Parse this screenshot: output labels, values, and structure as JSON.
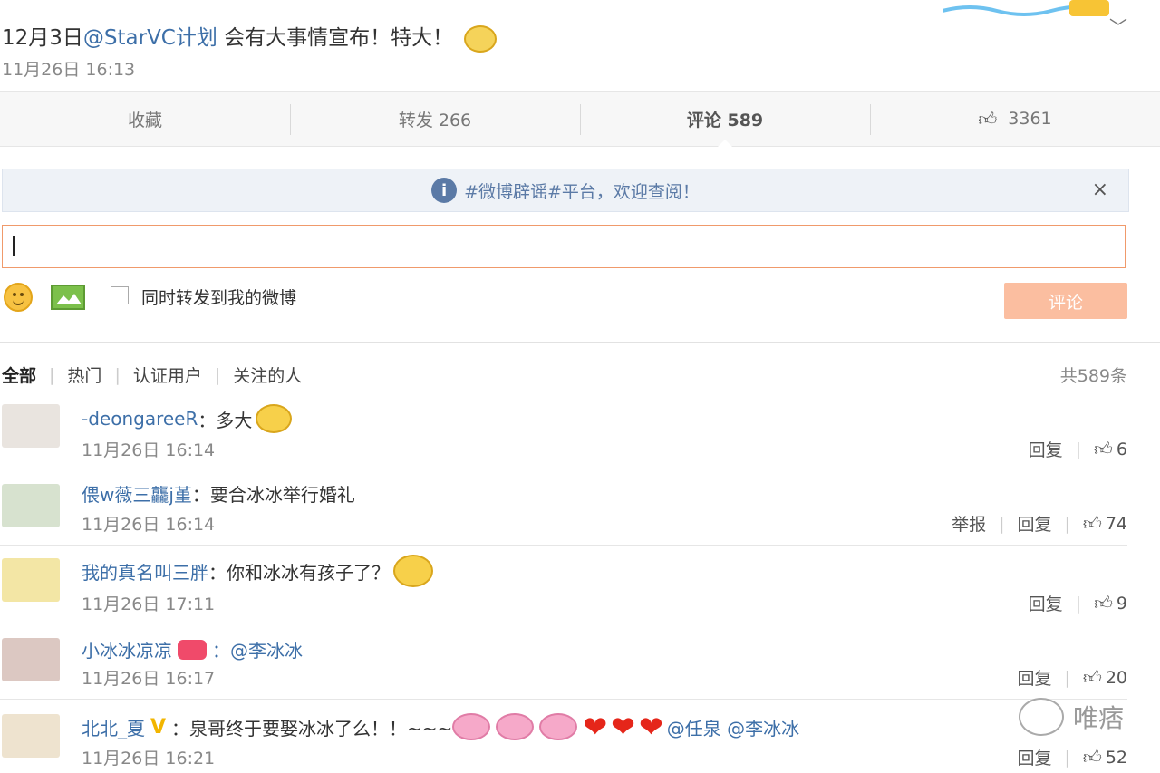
{
  "post": {
    "text_prefix": "12月3日",
    "mention": "@StarVC计划",
    "text_suffix": " 会有大事情宣布！特大！",
    "time": "11月26日 16:13"
  },
  "actions": {
    "favorite": "收藏",
    "repost": "转发 266",
    "comment": "评论 589",
    "like_count": "3361"
  },
  "notice": {
    "text": "#微博辟谣#平台，欢迎查阅！",
    "close": "×"
  },
  "composer": {
    "input_value": "",
    "repost_label": "同时转发到我的微博",
    "submit": "评论"
  },
  "filters": {
    "items": [
      "全部",
      "热门",
      "认证用户",
      "关注的人"
    ],
    "total": "共589条"
  },
  "comments": [
    {
      "user": "-deongareeR",
      "text": "：多大",
      "time": "11月26日 16:14",
      "reply": "回复",
      "likes": "6"
    },
    {
      "user": "偎w薇三龘j堇",
      "text": "：要合冰冰举行婚礼",
      "time": "11月26日 16:14",
      "report": "举报",
      "reply": "回复",
      "likes": "74"
    },
    {
      "user": "我的真名叫三胖",
      "text": "：你和冰冰有孩子了？",
      "time": "11月26日 17:11",
      "reply": "回复",
      "likes": "9"
    },
    {
      "user": "小冰冰凉凉",
      "text": "：@李冰冰",
      "time": "11月26日 16:17",
      "reply": "回复",
      "likes": "20"
    },
    {
      "user": "北北_夏",
      "badge": "V",
      "text": "：泉哥终于要娶冰冰了么！！~~~",
      "tail": "@任泉 @李冰冰",
      "time": "11月26日 16:21",
      "reply": "回复",
      "likes": "52"
    }
  ],
  "watermark": "唯痞",
  "colors": {
    "link": "#3d6fa8",
    "input_border": "#f09a6b",
    "submit_bg": "#fbbea0"
  }
}
